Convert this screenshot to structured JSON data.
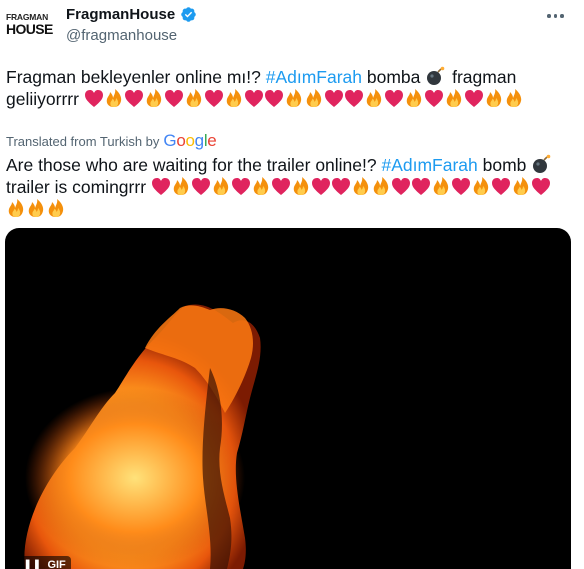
{
  "account": {
    "avatar_line1": "FRAGMAN",
    "avatar_line2": "HOUSE",
    "display_name": "FragmanHouse",
    "handle": "@fragmanhouse",
    "verified_color": "#1d9bf0"
  },
  "tweet": {
    "original_prefix": "Fragman bekleyenler online mı!? ",
    "original_hashtag": "#AdımFarah",
    "original_suffix": " bomba ",
    "original_after_bomb": " fragman geliiyorrrr ",
    "translated_label": "Translated from Turkish by",
    "translator_brand": "Google",
    "translation_prefix": "Are those who are waiting for the trailer online!? ",
    "translation_hashtag": "#AdımFarah",
    "translation_suffix": " bomb ",
    "translation_after_bomb": " trailer is comingrrr ",
    "original_emojis": [
      "heart",
      "fire",
      "heart",
      "fire",
      "heart",
      "fire",
      "heart",
      "fire",
      "heart",
      "heart",
      "fire",
      "fire",
      "heart",
      "heart",
      "fire",
      "heart",
      "fire",
      "heart",
      "fire",
      "heart",
      "fire",
      "fire"
    ],
    "translation_emojis": [
      "heart",
      "fire",
      "heart",
      "fire",
      "heart",
      "fire",
      "heart",
      "fire",
      "heart",
      "heart",
      "fire",
      "fire",
      "heart",
      "heart",
      "fire",
      "heart",
      "fire",
      "heart",
      "fire",
      "heart",
      "fire",
      "fire",
      "fire"
    ]
  },
  "media": {
    "type_badge": "GIF",
    "pause_glyph": "❚❚"
  },
  "colors": {
    "link": "#1d9bf0",
    "text": "#0f1419",
    "secondary": "#536471",
    "heart": "#e0245e"
  }
}
